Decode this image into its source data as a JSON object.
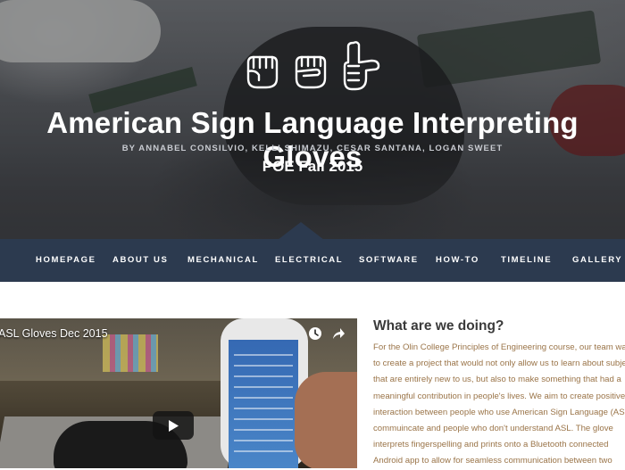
{
  "hero": {
    "icons": [
      "asl-letter-a-icon",
      "asl-letter-s-icon",
      "asl-letter-l-icon"
    ],
    "title": "American Sign Language Interpreting Gloves",
    "byline": "BY ANNABEL CONSILVIO, KELLI SHIMAZU, CESAR SANTANA, LOGAN SWEET",
    "subtitle": "POE Fall 2015"
  },
  "nav": {
    "items": [
      "HOMEPAGE",
      "ABOUT US",
      "MECHANICAL",
      "ELECTRICAL",
      "SOFTWARE",
      "HOW-TO",
      "TIMELINE",
      "GALLERY"
    ]
  },
  "video": {
    "title": "ASL Gloves Dec 2015",
    "icons": [
      "clock-icon",
      "share-icon",
      "play-icon"
    ]
  },
  "article": {
    "heading": "What are we doing?",
    "lines": [
      "For the Olin College Principles of Engineering course, our team wanted",
      "to create a project that would not only allow us to learn about subjects",
      "that are entirely new to us, but also to make something that had a",
      "meaningful contribution in people's lives. We aim to create positive",
      "interaction between people who use American Sign Language (ASL) to",
      "commuincate and people who don't understand ASL. The glove",
      "interprets fingerspelling and prints onto a Bluetooth connected",
      "Android app to allow for seamless communication between two"
    ]
  },
  "colors": {
    "nav_background": "#2c3a4f",
    "article_text": "#9a7448",
    "heading_text": "#3a3a3a"
  }
}
